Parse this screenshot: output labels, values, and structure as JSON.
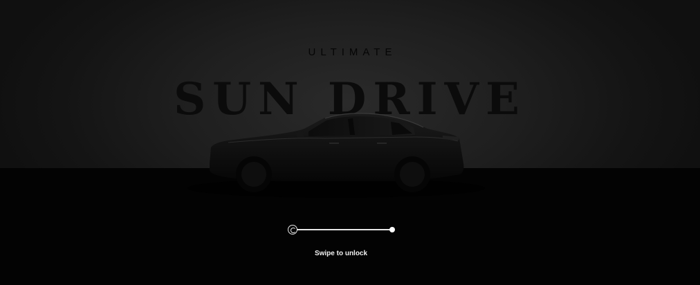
{
  "hero": {
    "kicker": "ULTIMATE",
    "headline": "SUN DRIVE"
  },
  "unlock": {
    "hint": "Swipe to unlock",
    "progress": 0,
    "handle_icon": "circle-arrow-icon",
    "end_icon": "dot-icon"
  },
  "colors": {
    "background": "#030303",
    "backdrop": "#1f1f1f",
    "slider": "#e8e8e8",
    "hint_text": "#f2f2f2"
  }
}
